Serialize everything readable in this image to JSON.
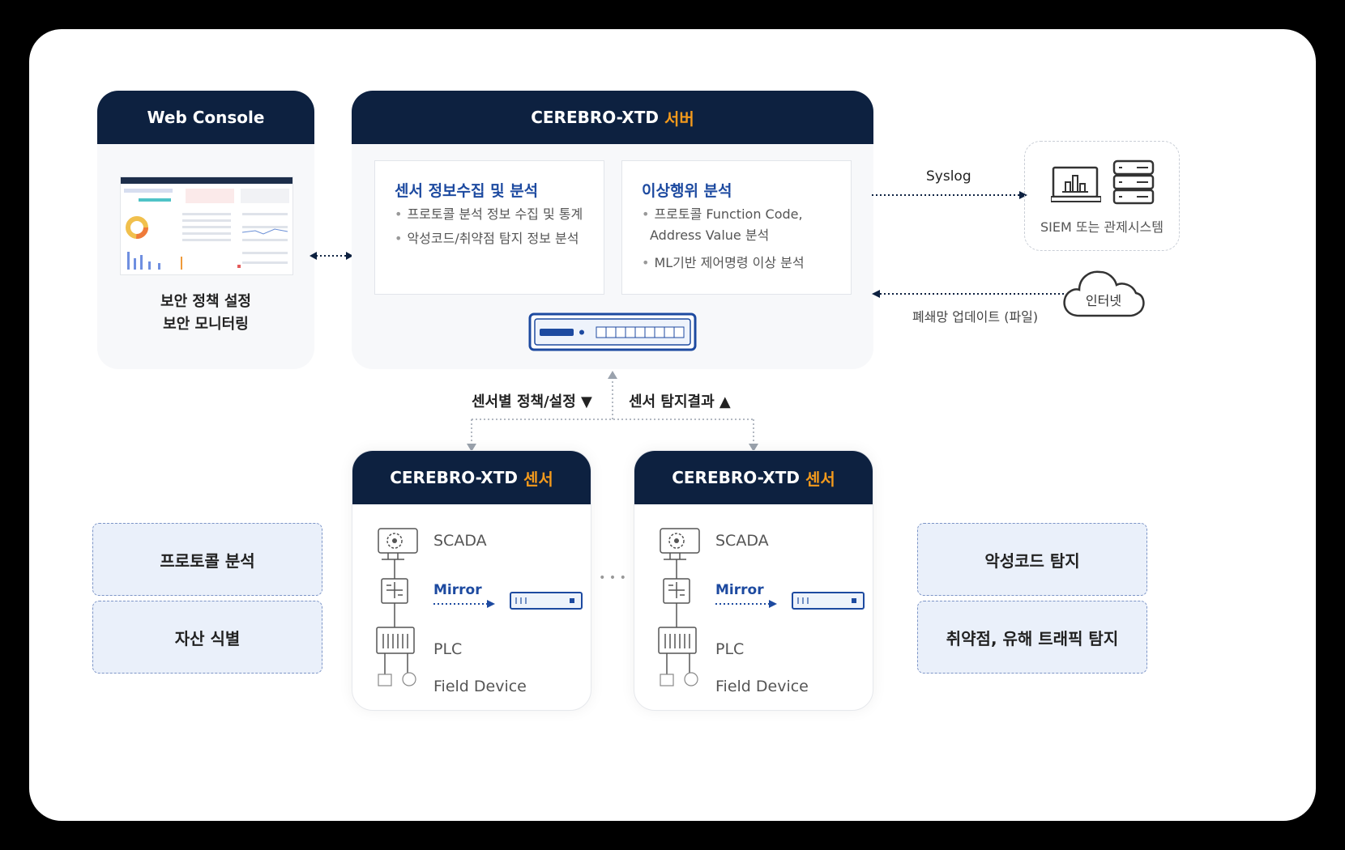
{
  "web_console": {
    "title": "Web Console",
    "captions": [
      "보안 정책 설정",
      "보안 모니터링"
    ]
  },
  "server": {
    "title_main": "CEREBRO-XTD",
    "title_accent": "서버",
    "cards": [
      {
        "title": "센서 정보수집 및 분석",
        "bullets": [
          "프로토콜 분석 정보 수집 및 통계",
          "악성코드/취약점 탐지 정보 분석"
        ]
      },
      {
        "title": "이상행위 분석",
        "bullets": [
          "프로토콜 Function Code,",
          "Address Value 분석",
          "ML기반 제어명령 이상 분석"
        ]
      }
    ]
  },
  "external": {
    "syslog_label": "Syslog",
    "siem_label": "SIEM 또는 관제시스템",
    "internet_label": "인터넷",
    "update_label": "폐쇄망 업데이트 (파일)"
  },
  "flows": {
    "down_label": "센서별 정책/설정 ▼",
    "up_label": "센서 탐지결과 ▲"
  },
  "sensors": [
    {
      "title_main": "CEREBRO-XTD",
      "title_accent": "센서",
      "scada": "SCADA",
      "mirror": "Mirror",
      "plc": "PLC",
      "field": "Field Device"
    },
    {
      "title_main": "CEREBRO-XTD",
      "title_accent": "센서",
      "scada": "SCADA",
      "mirror": "Mirror",
      "plc": "PLC",
      "field": "Field Device"
    }
  ],
  "ellipsis": "• • •",
  "features_left": [
    "프로토콜 분석",
    "자산 식별"
  ],
  "features_right": [
    "악성코드 탐지",
    "취약점, 유해 트래픽 탐지"
  ],
  "colors": {
    "navy": "#0d2140",
    "accent": "#f39a1c",
    "blue": "#1d4aa0",
    "feature_bg": "#eaf0fa"
  }
}
